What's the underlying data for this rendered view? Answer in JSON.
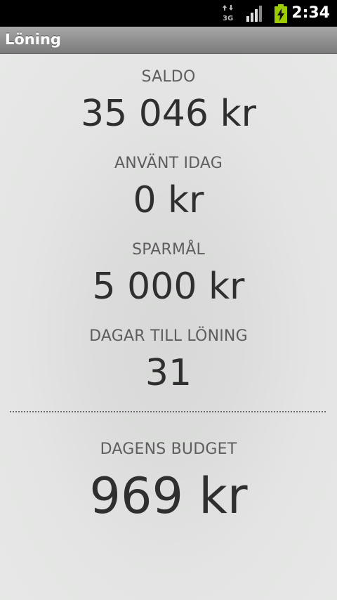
{
  "status_bar": {
    "network_type": "3G",
    "time": "2:34",
    "icons": [
      "network-3g-icon",
      "signal-strength-icon",
      "battery-charging-icon"
    ]
  },
  "app": {
    "title": "Löning"
  },
  "stats": {
    "balance": {
      "label": "SALDO",
      "value": "35 046 kr"
    },
    "spent_today": {
      "label": "ANVÄNT IDAG",
      "value": "0 kr"
    },
    "savings_goal": {
      "label": "SPARMÅL",
      "value": "5 000 kr"
    },
    "days_to_payday": {
      "label": "DAGAR TILL LÖNING",
      "value": "31"
    }
  },
  "daily_budget": {
    "label": "DAGENS BUDGET",
    "value": "969 kr"
  },
  "colors": {
    "accent_battery": "#9ccc00"
  }
}
